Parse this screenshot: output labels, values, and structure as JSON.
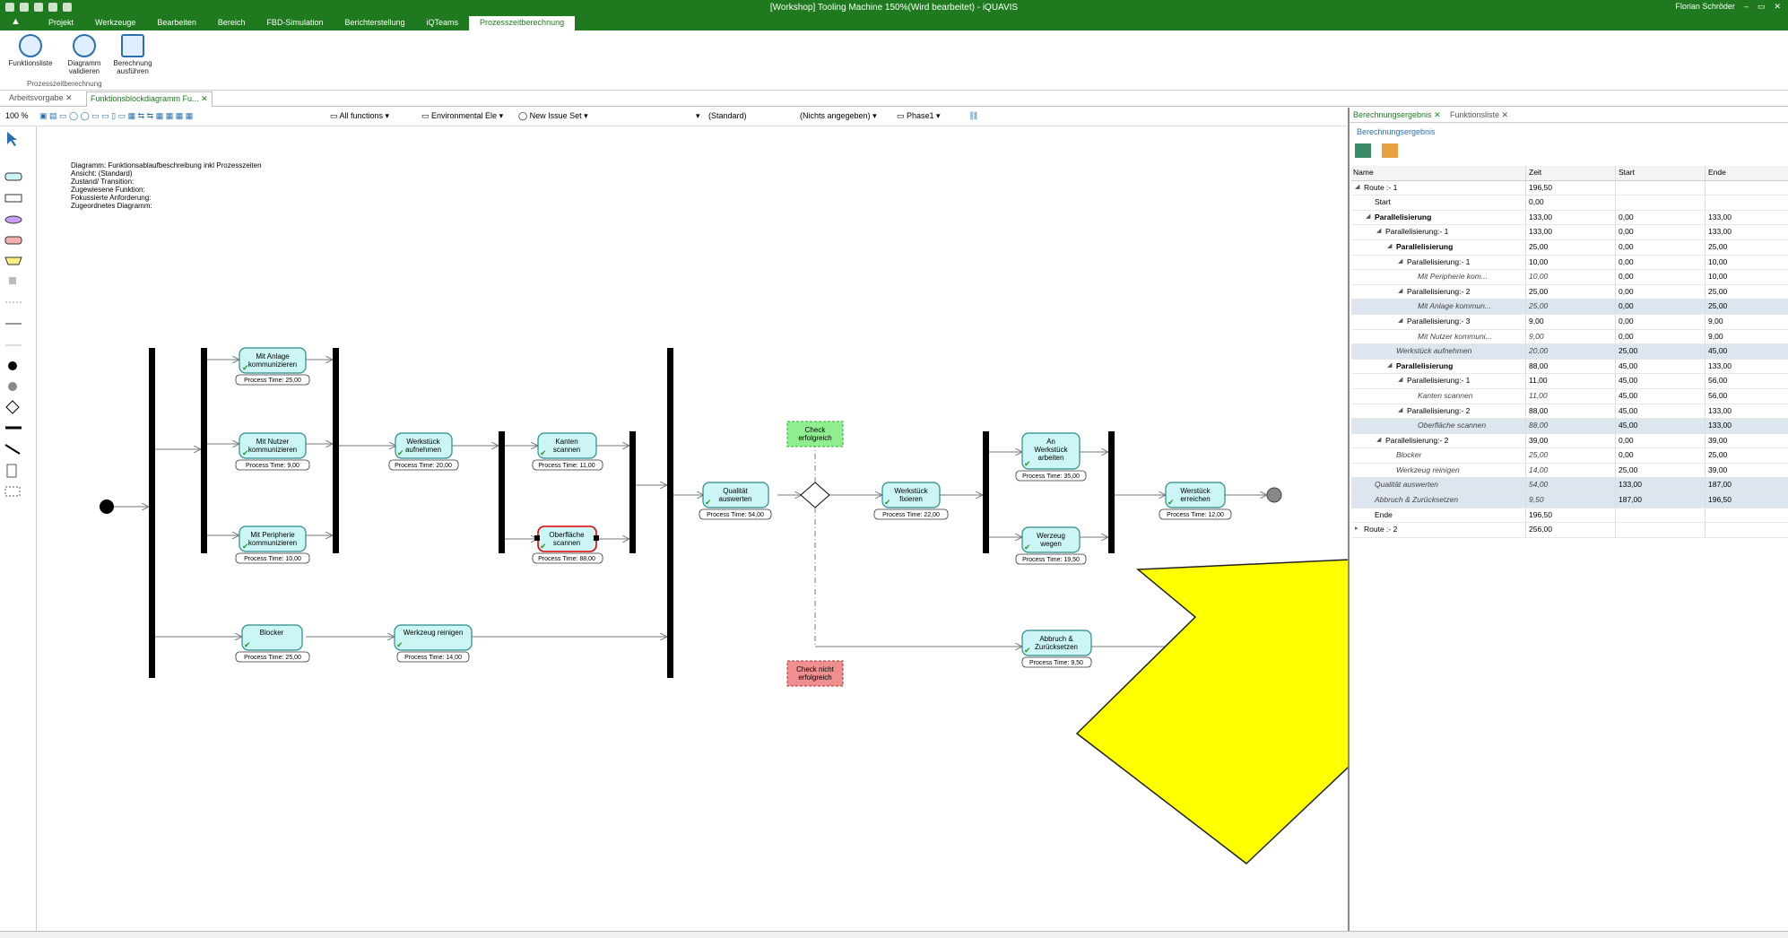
{
  "window": {
    "title": "[Workshop] Tooling Machine 150%(Wird bearbeitet) - iQUAVIS",
    "user": "Florian Schröder"
  },
  "menu": [
    "Projekt",
    "Werkzeuge",
    "Bearbeiten",
    "Bereich",
    "FBD-Simulation",
    "Berichterstellung",
    "iQTeams",
    "Prozesszeitberechnung"
  ],
  "ribbon": {
    "buttons": [
      "Funktionsliste",
      "Diagramm validieren",
      "Berechnung ausführen"
    ],
    "group_label": "Prozesszeitberechnung"
  },
  "doc_tabs": [
    "Arbeitsvorgabe",
    "Funktionsblockdiagramm Fu..."
  ],
  "toolbar": {
    "zoom": "100 %",
    "functions": "All functions",
    "env": "Environmental Ele",
    "issue": "New Issue Set",
    "standard": "(Standard)",
    "nicht": "(Nichts angegeben)",
    "phase": "Phase1"
  },
  "diagram_info": [
    "Diagramm: Funktionsablaufbeschreibung inkl Prozesszeiten",
    "Ansicht: (Standard)",
    "Zustand/ Transition:",
    "Zugewiesene Funktion:",
    "Fokussierte Anforderung:",
    "Zugeordnetes Diagramm:"
  ],
  "nodes": {
    "anlage": {
      "l1": "Mit Anlage",
      "l2": "kommunizieren",
      "pt": "Process Time: 25,00"
    },
    "nutzer": {
      "l1": "Mit Nutzer",
      "l2": "kommunizieren",
      "pt": "Process Time: 9,00"
    },
    "peripherie": {
      "l1": "Mit Peripherie",
      "l2": "kommunizieren",
      "pt": "Process Time: 10,00"
    },
    "aufnehmen": {
      "l1": "Werkstück",
      "l2": "aufnehmen",
      "pt": "Process Time: 20,00"
    },
    "kanten": {
      "l1": "Kanten",
      "l2": "scannen",
      "pt": "Process Time: 11,00"
    },
    "oberflaeche": {
      "l1": "Oberfläche",
      "l2": "scannen",
      "pt": "Process Time: 88,00"
    },
    "qualitaet": {
      "l1": "Qualität",
      "l2": "auswerten",
      "pt": "Process Time: 54,00"
    },
    "fixieren": {
      "l1": "Werkstück",
      "l2": "fixieren",
      "pt": "Process Time: 22,00"
    },
    "bearbeiten": {
      "l1": "An",
      "l2": "Werkstück",
      "l3": "arbeiten",
      "pt": "Process Time: 35,00"
    },
    "wegen": {
      "l1": "Werzeug",
      "l2": "wegen",
      "pt": "Process Time: 19,50"
    },
    "erreichen": {
      "l1": "Werstück",
      "l2": "erreichen",
      "pt": "Process Time: 12,00"
    },
    "blocker": {
      "l1": "Blocker",
      "pt": "Process Time: 25,00"
    },
    "reinigen": {
      "l1": "Werkzeug reinigen",
      "pt": "Process Time: 14,00"
    },
    "abbruch": {
      "l1": "Abbruch &",
      "l2": "Zurücksetzen",
      "pt": "Process Time: 9,50"
    },
    "check_ok": {
      "l1": "Check",
      "l2": "erfolgreich"
    },
    "check_fail": {
      "l1": "Check nicht",
      "l2": "erfolgreich"
    }
  },
  "results": {
    "tabs": [
      "Berechnungsergebnis",
      "Funktionsliste"
    ],
    "subtitle": "Berechnungsergebnis",
    "columns": [
      "Name",
      "Zeit",
      "Start",
      "Ende"
    ],
    "rows": [
      {
        "name": "Route :- 1",
        "zeit": "196,50",
        "start": "",
        "ende": "",
        "indent": 0,
        "tw": "◢"
      },
      {
        "name": "Start",
        "zeit": "0,00",
        "start": "",
        "ende": "",
        "indent": 1,
        "tw": ""
      },
      {
        "name": "Parallelisierung",
        "zeit": "133,00",
        "start": "0,00",
        "ende": "133,00",
        "indent": 1,
        "tw": "◢",
        "bold": true
      },
      {
        "name": "Parallelisierung:- 1",
        "zeit": "133,00",
        "start": "0,00",
        "ende": "133,00",
        "indent": 2,
        "tw": "◢"
      },
      {
        "name": "Parallelisierung",
        "zeit": "25,00",
        "start": "0,00",
        "ende": "25,00",
        "indent": 3,
        "tw": "◢",
        "bold": true
      },
      {
        "name": "Parallelisierung:- 1",
        "zeit": "10,00",
        "start": "0,00",
        "ende": "10,00",
        "indent": 4,
        "tw": "◢"
      },
      {
        "name": "Mit Peripherie kom...",
        "zeit": "10,00",
        "start": "0,00",
        "ende": "10,00",
        "indent": 5,
        "tw": "",
        "ital": true
      },
      {
        "name": "Parallelisierung:- 2",
        "zeit": "25,00",
        "start": "0,00",
        "ende": "25,00",
        "indent": 4,
        "tw": "◢"
      },
      {
        "name": "Mit Anlage kommun...",
        "zeit": "25,00",
        "start": "0,00",
        "ende": "25,00",
        "indent": 5,
        "tw": "",
        "ital": true,
        "hl": true
      },
      {
        "name": "Parallelisierung:- 3",
        "zeit": "9,00",
        "start": "0,00",
        "ende": "9,00",
        "indent": 4,
        "tw": "◢"
      },
      {
        "name": "Mit Nutzer kommuni...",
        "zeit": "9,00",
        "start": "0,00",
        "ende": "9,00",
        "indent": 5,
        "tw": "",
        "ital": true
      },
      {
        "name": "Werkstück aufnehmen",
        "zeit": "20,00",
        "start": "25,00",
        "ende": "45,00",
        "indent": 3,
        "tw": "",
        "ital": true,
        "hl": true
      },
      {
        "name": "Parallelisierung",
        "zeit": "88,00",
        "start": "45,00",
        "ende": "133,00",
        "indent": 3,
        "tw": "◢",
        "bold": true
      },
      {
        "name": "Parallelisierung:- 1",
        "zeit": "11,00",
        "start": "45,00",
        "ende": "56,00",
        "indent": 4,
        "tw": "◢"
      },
      {
        "name": "Kanten scannen",
        "zeit": "11,00",
        "start": "45,00",
        "ende": "56,00",
        "indent": 5,
        "tw": "",
        "ital": true
      },
      {
        "name": "Parallelisierung:- 2",
        "zeit": "88,00",
        "start": "45,00",
        "ende": "133,00",
        "indent": 4,
        "tw": "◢"
      },
      {
        "name": "Oberfläche scannen",
        "zeit": "88,00",
        "start": "45,00",
        "ende": "133,00",
        "indent": 5,
        "tw": "",
        "ital": true,
        "hl": true
      },
      {
        "name": "Parallelisierung:- 2",
        "zeit": "39,00",
        "start": "0,00",
        "ende": "39,00",
        "indent": 2,
        "tw": "◢"
      },
      {
        "name": "Blocker",
        "zeit": "25,00",
        "start": "0,00",
        "ende": "25,00",
        "indent": 3,
        "tw": "",
        "ital": true
      },
      {
        "name": "Werkzeug reinigen",
        "zeit": "14,00",
        "start": "25,00",
        "ende": "39,00",
        "indent": 3,
        "tw": "",
        "ital": true
      },
      {
        "name": "Qualität auswerten",
        "zeit": "54,00",
        "start": "133,00",
        "ende": "187,00",
        "indent": 1,
        "tw": "",
        "ital": true,
        "hl": true
      },
      {
        "name": "Abbruch & Zurücksetzen",
        "zeit": "9,50",
        "start": "187,00",
        "ende": "196,50",
        "indent": 1,
        "tw": "",
        "ital": true,
        "hl": true
      },
      {
        "name": "Ende",
        "zeit": "196,50",
        "start": "",
        "ende": "",
        "indent": 1,
        "tw": ""
      },
      {
        "name": "Route :- 2",
        "zeit": "256,00",
        "start": "",
        "ende": "",
        "indent": 0,
        "tw": "▸"
      }
    ]
  },
  "colors": {
    "brand_green": "#1f7a1f",
    "node_fill": "#ccf5f5",
    "check_ok": "#8fef8f",
    "check_fail": "#f08f8f",
    "arrow_overlay": "#ffff00"
  }
}
